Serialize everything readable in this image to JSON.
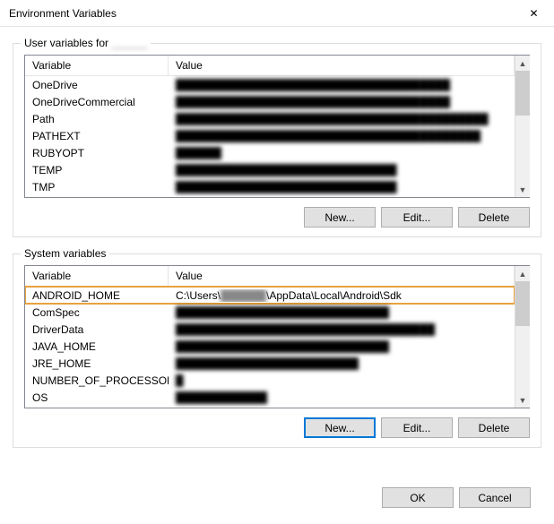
{
  "window": {
    "title": "Environment Variables",
    "close_label": "✕"
  },
  "user_section": {
    "label_prefix": "User variables for ",
    "label_user": "______",
    "columns": {
      "name": "Variable",
      "value": "Value"
    },
    "rows": [
      {
        "name": "OneDrive",
        "value": "████████████████████████████████████",
        "blurred": true
      },
      {
        "name": "OneDriveCommercial",
        "value": "████████████████████████████████████",
        "blurred": true
      },
      {
        "name": "Path",
        "value": "█████████████████████████████████████████",
        "blurred": true
      },
      {
        "name": "PATHEXT",
        "value": "████████████████████████████████████████",
        "blurred": true
      },
      {
        "name": "RUBYOPT",
        "value": "██████",
        "blurred": true
      },
      {
        "name": "TEMP",
        "value": "█████████████████████████████",
        "blurred": true
      },
      {
        "name": "TMP",
        "value": "█████████████████████████████",
        "blurred": true
      }
    ],
    "buttons": {
      "new": "New...",
      "edit": "Edit...",
      "delete": "Delete"
    }
  },
  "system_section": {
    "label": "System variables",
    "columns": {
      "name": "Variable",
      "value": "Value"
    },
    "rows": [
      {
        "name": "ANDROID_HOME",
        "value_pre": "C:\\Users\\",
        "value_blur": "██████",
        "value_post": "\\AppData\\Local\\Android\\Sdk",
        "highlighted": true
      },
      {
        "name": "ComSpec",
        "value": "████████████████████████████",
        "blurred": true
      },
      {
        "name": "DriverData",
        "value": "██████████████████████████████████",
        "blurred": true
      },
      {
        "name": "JAVA_HOME",
        "value": "████████████████████████████",
        "blurred": true
      },
      {
        "name": "JRE_HOME",
        "value": "████████████████████████",
        "blurred": true
      },
      {
        "name": "NUMBER_OF_PROCESSORS",
        "value": "█",
        "blurred": true
      },
      {
        "name": "OS",
        "value": "████████████",
        "blurred": true
      }
    ],
    "buttons": {
      "new": "New...",
      "edit": "Edit...",
      "delete": "Delete"
    }
  },
  "footer": {
    "ok": "OK",
    "cancel": "Cancel"
  }
}
